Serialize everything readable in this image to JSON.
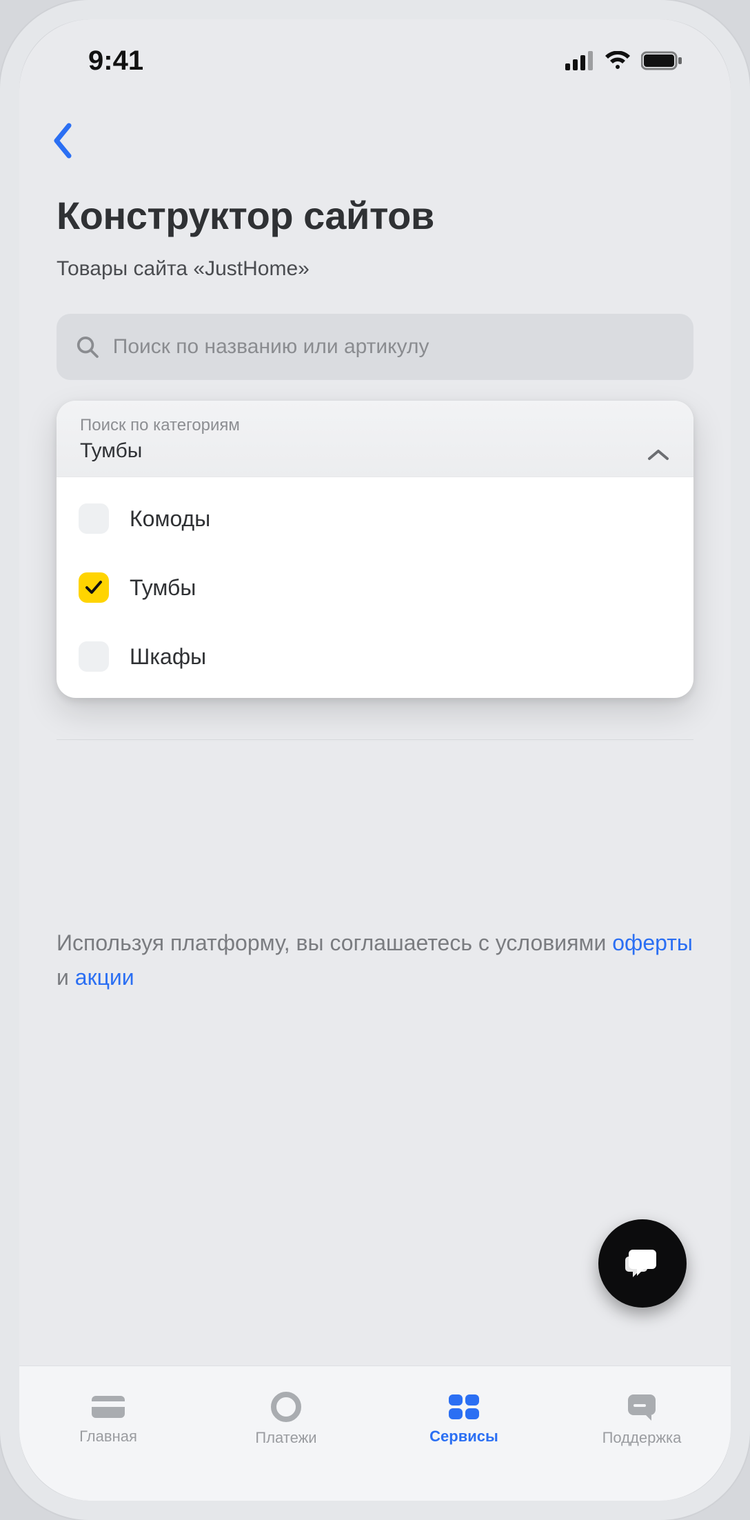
{
  "status": {
    "time": "9:41"
  },
  "header": {
    "title": "Конструктор сайтов",
    "subtitle": "Товары сайта «JustHome»"
  },
  "search": {
    "placeholder": "Поиск по названию или артикулу"
  },
  "category": {
    "label": "Поиск по категориям",
    "selected": "Тумбы",
    "options": [
      {
        "name": "Комоды",
        "checked": false
      },
      {
        "name": "Тумбы",
        "checked": true
      },
      {
        "name": "Шкафы",
        "checked": false
      }
    ]
  },
  "terms": {
    "prefix": "Используя платформу, вы соглашаетесь с условиями ",
    "link1": "оферты",
    "mid": " и  ",
    "link2": "акции"
  },
  "tabs": [
    {
      "label": "Главная",
      "icon": "card",
      "active": false
    },
    {
      "label": "Платежи",
      "icon": "circle",
      "active": false
    },
    {
      "label": "Сервисы",
      "icon": "grid",
      "active": true
    },
    {
      "label": "Поддержка",
      "icon": "chat",
      "active": false
    }
  ]
}
